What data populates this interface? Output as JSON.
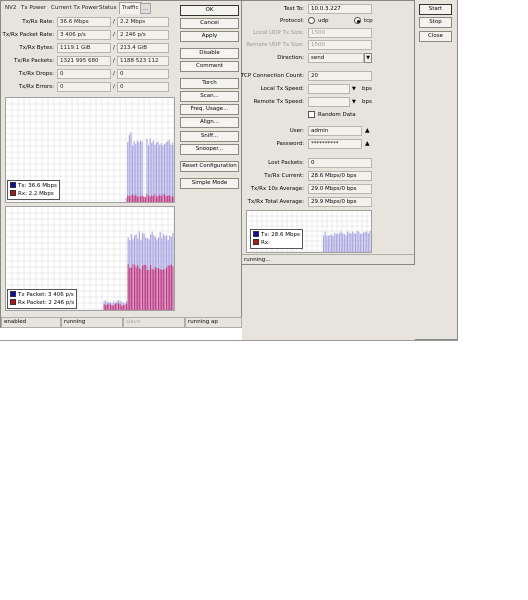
{
  "tabs": [
    "NV2",
    "Tx Power",
    "Current Tx Power",
    "Status",
    "Traffic",
    "..."
  ],
  "traffic": {
    "rows": [
      {
        "label": "Tx/Rx Rate:",
        "tx": "36.6 Mbps",
        "rx": "2.2 Mbps"
      },
      {
        "label": "Tx/Rx Packet Rate:",
        "tx": "3 406 p/s",
        "rx": "2 246 p/s"
      },
      {
        "label": "Tx/Rx Bytes:",
        "tx": "1119.1 GiB",
        "rx": "213.4 GiB"
      },
      {
        "label": "Tx/Rx Packets:",
        "tx": "1321 995 680",
        "rx": "1188 523 112"
      },
      {
        "label": "Tx/Rx Drops:",
        "tx": "0",
        "rx": "0"
      },
      {
        "label": "Tx/Rx Errors:",
        "tx": "0",
        "rx": "0"
      }
    ],
    "slash": "/"
  },
  "buttons_left": [
    "OK",
    "Cancel",
    "Apply",
    "Disable",
    "Comment",
    "Torch",
    "Scan...",
    "Freq. Usage...",
    "Align...",
    "Sniff...",
    "Snooper...",
    "Reset Configuration",
    "Simple Mode"
  ],
  "chart_rate_legend": {
    "tx": "Tx:  36.6 Mbps",
    "rx": "Rx:  2.2 Mbps"
  },
  "chart_packet_legend": {
    "tx": "Tx Packet:  3 406 p/s",
    "rx": "Rx Packet:  2 246 p/s"
  },
  "status_left": [
    "enabled",
    "running",
    "slave",
    "running ap"
  ],
  "colors": {
    "tx": "#1010a8",
    "rx": "#b01818",
    "tx_fill": "#a8a4e0",
    "rx_fill": "#c03880",
    "grid": "#d8d8d8"
  },
  "btest": {
    "test_to_label": "Test To:",
    "test_to": "10.0.3.227",
    "protocol_label": "Protocol:",
    "protocol_udp": "udp",
    "protocol_tcp": "tcp",
    "local_udp_label": "Local UDP Tx Size:",
    "local_udp": "1500",
    "remote_udp_label": "Remote UDP Tx Size:",
    "remote_udp": "1500",
    "direction_label": "Direction:",
    "direction": "send",
    "tcp_count_label": "TCP Connection Count:",
    "tcp_count": "20",
    "local_speed_label": "Local Tx Speed:",
    "remote_speed_label": "Remote Tx Speed:",
    "bps": "bps",
    "random_data": "Random Data",
    "user_label": "User:",
    "user": "admin",
    "password_label": "Password:",
    "password": "**********",
    "lost_label": "Lost Packets:",
    "lost": "0",
    "current_label": "Tx/Rx Current:",
    "current": "28.6 Mbps/0 bps",
    "avg10_label": "Tx/Rx 10s Average:",
    "avg10": "29.0 Mbps/0 bps",
    "total_label": "Tx/Rx Total Average:",
    "total": "29.9 Mbps/0 bps",
    "legend_tx": "Tx:  28.6 Mbps",
    "legend_rx": "Rx:",
    "status": "running..."
  },
  "buttons_right": [
    "Start",
    "Stop",
    "Close"
  ]
}
